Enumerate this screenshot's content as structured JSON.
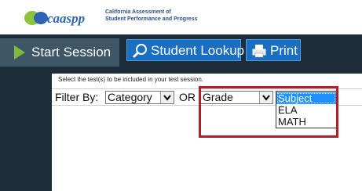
{
  "header": {
    "logo_icon": "caaspp-logo",
    "logo_text": "caaspp",
    "org_line1": "California Assessment of",
    "org_line2": "Student Performance and Progress"
  },
  "toolbar": {
    "start_session_label": "Start Session",
    "student_lookup_label": "Student Lookup",
    "print_label": "Print",
    "icons": {
      "start": "play-icon",
      "lookup": "search-icon",
      "print": "printer-icon"
    }
  },
  "panel": {
    "instructions": "Select the test(s) to be included in your test session.",
    "filter_by_label": "Filter By:",
    "category_value": "Category",
    "or_label": "OR",
    "grade_value": "Grade",
    "dropdown_options": [
      "Subject",
      "ELA",
      "MATH"
    ],
    "dropdown_selected": "Subject"
  },
  "colors": {
    "toolbar_bg": "#1d2e3a",
    "button_blue": "#1b6fc2",
    "play_green": "#7dbb3e",
    "highlight_red": "#b0202a",
    "selection_blue": "#1e90ff"
  }
}
